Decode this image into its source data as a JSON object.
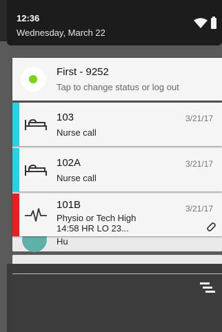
{
  "status_bar": {
    "time": "12:36",
    "date": "Wednesday, March 22",
    "wifi_icon": "wifi-icon",
    "battery_icon": "battery-icon"
  },
  "notifications": [
    {
      "title": "First - 9252",
      "subtitle": "Tap to change status or log out",
      "icon": "status-dot-icon",
      "accent": "#79d414"
    },
    {
      "title": "103",
      "subtitle": "Nurse call",
      "time": "3/21/17",
      "icon": "bed-icon",
      "accent": "#22d3e8"
    },
    {
      "title": "102A",
      "subtitle": "Nurse call",
      "time": "3/21/17",
      "icon": "bed-icon",
      "accent": "#22d3e8"
    },
    {
      "title": "101B",
      "subtitle": "Physio or Tech High",
      "detail": "14:58 HR LO 23...",
      "time": "3/21/17",
      "icon": "heartbeat-icon",
      "accent": "#ee1c1c",
      "attachment_icon": "attachment-icon"
    }
  ],
  "background": {
    "text": "Hu"
  },
  "clear_all_icon": "clear-all-icon"
}
